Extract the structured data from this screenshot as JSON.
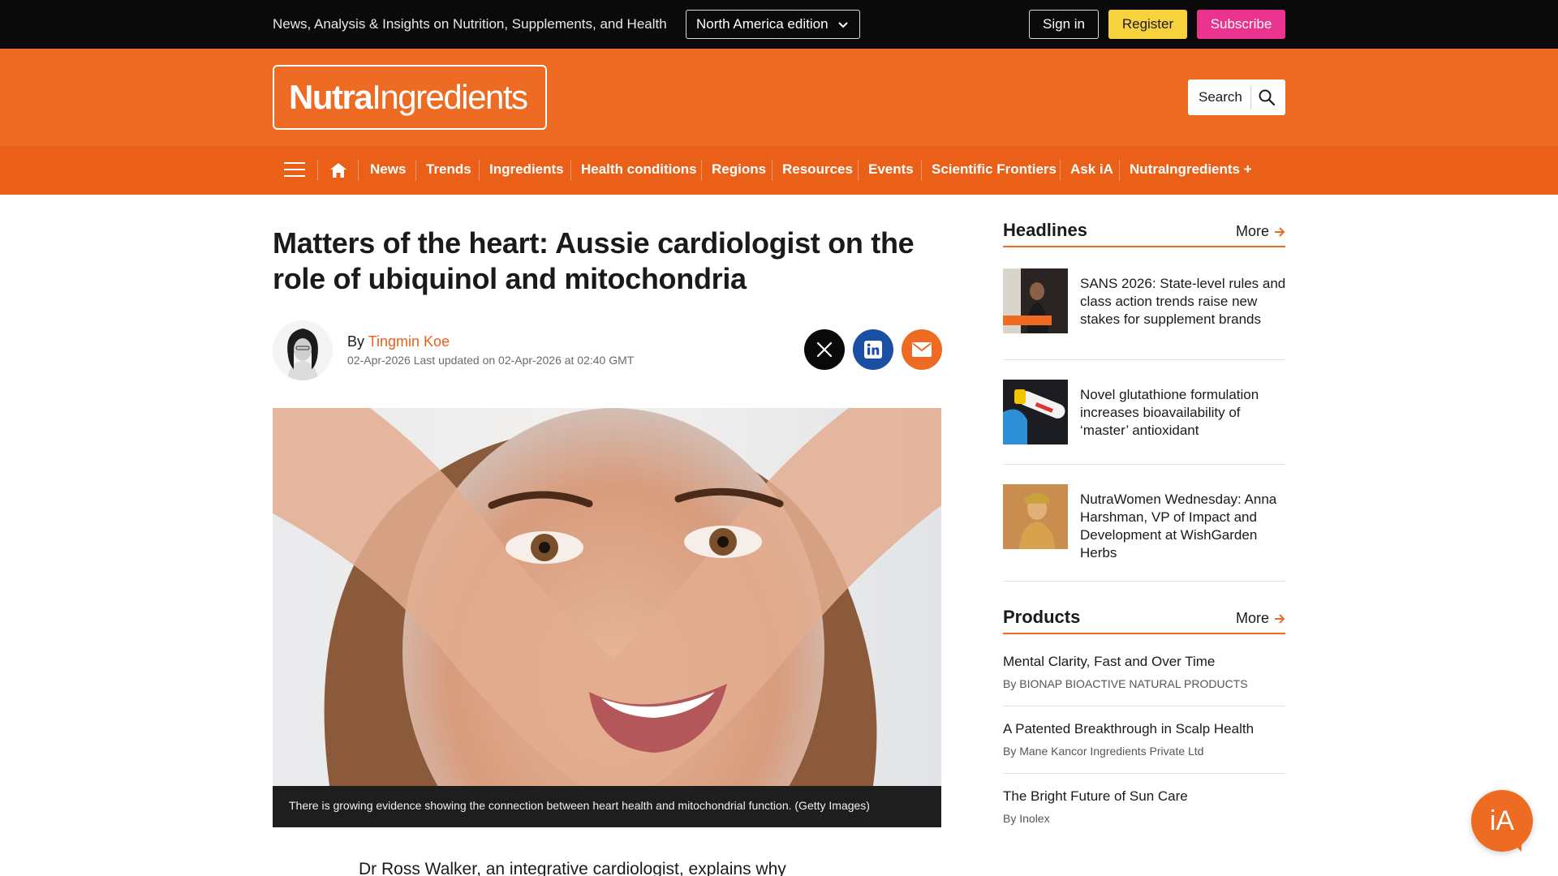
{
  "topbar": {
    "tagline": "News, Analysis & Insights on Nutrition, Supplements, and Health",
    "edition": "North America edition",
    "sign_in": "Sign in",
    "register": "Register",
    "subscribe": "Subscribe"
  },
  "brand": {
    "logo_bold": "Nutra",
    "logo_light": "Ingredients",
    "search_label": "Search"
  },
  "nav": {
    "items": [
      "News",
      "Trends",
      "Ingredients",
      "Health conditions",
      "Regions",
      "Resources",
      "Events",
      "Scientific Frontiers",
      "Ask iA",
      "NutraIngredients +"
    ]
  },
  "article": {
    "title": "Matters of the heart: Aussie cardiologist on the role of ubiquinol and mitochondria",
    "by_prefix": "By",
    "author": "Tingmin Koe",
    "dates": "02-Apr-2026 Last updated on 02-Apr-2026 at 02:40 GMT",
    "caption": "There is growing evidence showing the connection between heart health and mitochondrial function. (Getty Images)",
    "lead": "Dr Ross Walker, an integrative cardiologist, explains why"
  },
  "sidebar": {
    "headlines_title": "Headlines",
    "products_title": "Products",
    "more_label": "More",
    "headlines": [
      {
        "text": "SANS 2026: State-level rules and class action trends raise new stakes for supplement brands"
      },
      {
        "text": "Novel glutathione formulation increases bioavailability of ‘master’ antioxidant"
      },
      {
        "text": "NutraWomen Wednesday: Anna Harshman, VP of Impact and Development at WishGarden Herbs"
      }
    ],
    "products": [
      {
        "title": "Mental Clarity, Fast and Over Time",
        "by": "By BIONAP BIOACTIVE NATURAL PRODUCTS"
      },
      {
        "title": "A Patented Breakthrough in Scalp Health",
        "by": "By Mane Kancor Ingredients Private Ltd"
      },
      {
        "title": "The Bright Future of Sun Care",
        "by": "By Inolex"
      }
    ]
  },
  "assistant": {
    "label": "iA"
  },
  "colors": {
    "brand_orange": "#ee6b24",
    "nav_orange": "#ea6018",
    "register_yellow": "#f6d33c",
    "subscribe_pink": "#e9338f",
    "linkedin_blue": "#1a4fa3"
  }
}
